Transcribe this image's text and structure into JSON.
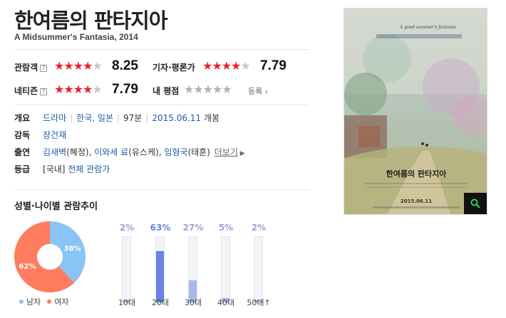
{
  "movie": {
    "title": "한여름의 판타지아",
    "subtitle": "A Midsummer's Fantasia, 2014"
  },
  "ratings": {
    "audience": {
      "label": "관람객",
      "help": "?",
      "score": "8.25",
      "stars_filled": 4,
      "stars_total": 5
    },
    "critics": {
      "label": "기자·평론가",
      "score": "7.79",
      "stars_filled": 4,
      "stars_total": 5
    },
    "netizen": {
      "label": "네티즌",
      "help": "?",
      "score": "7.79",
      "stars_filled": 4,
      "stars_total": 5
    },
    "mine": {
      "label": "내 평점",
      "register": "등록",
      "stars_filled": 0,
      "stars_total": 5
    }
  },
  "info": {
    "overview": {
      "label": "개요",
      "genre": "드라마",
      "country1": "한국",
      "country2": "일본",
      "runtime": "97분",
      "release_date": "2015.06.11",
      "release_suffix": "개봉"
    },
    "director": {
      "label": "감독",
      "name": "장건재"
    },
    "cast": {
      "label": "출연",
      "actor1": "김새벽",
      "role1": "(혜정)",
      "actor2": "이와세 료",
      "role2": "(유스케)",
      "actor3": "임형국",
      "role3": "(태훈)",
      "more": "더보기"
    },
    "grade": {
      "label": "등급",
      "prefix": "[국내]",
      "value": "전체 관람가"
    }
  },
  "chart_section": {
    "title": "성별·나이별 관람추이"
  },
  "chart_data": [
    {
      "type": "pie",
      "labels": [
        "남자",
        "여자"
      ],
      "values": [
        38,
        62
      ],
      "value_labels": [
        "38%",
        "62%"
      ],
      "colors": [
        "#8ac3f5",
        "#ff7d5e"
      ]
    },
    {
      "type": "bar",
      "categories": [
        "10대",
        "20대",
        "30대",
        "40대",
        "50대↑"
      ],
      "values": [
        2,
        63,
        27,
        5,
        2
      ],
      "value_labels": [
        "2%",
        "63%",
        "27%",
        "5%",
        "2%"
      ],
      "ylim": [
        0,
        100
      ],
      "colors": {
        "highlight": "#6b82e3",
        "normal": "#a9b8e8",
        "track": "#f3f4f6"
      }
    }
  ],
  "poster": {
    "tagline": "A good summer's fantasia",
    "title": "한여름의 판타지아",
    "date": "2015.06.11"
  },
  "icons": {
    "search": "search-icon",
    "chevron": "chevron-right-icon",
    "help": "help-icon"
  }
}
